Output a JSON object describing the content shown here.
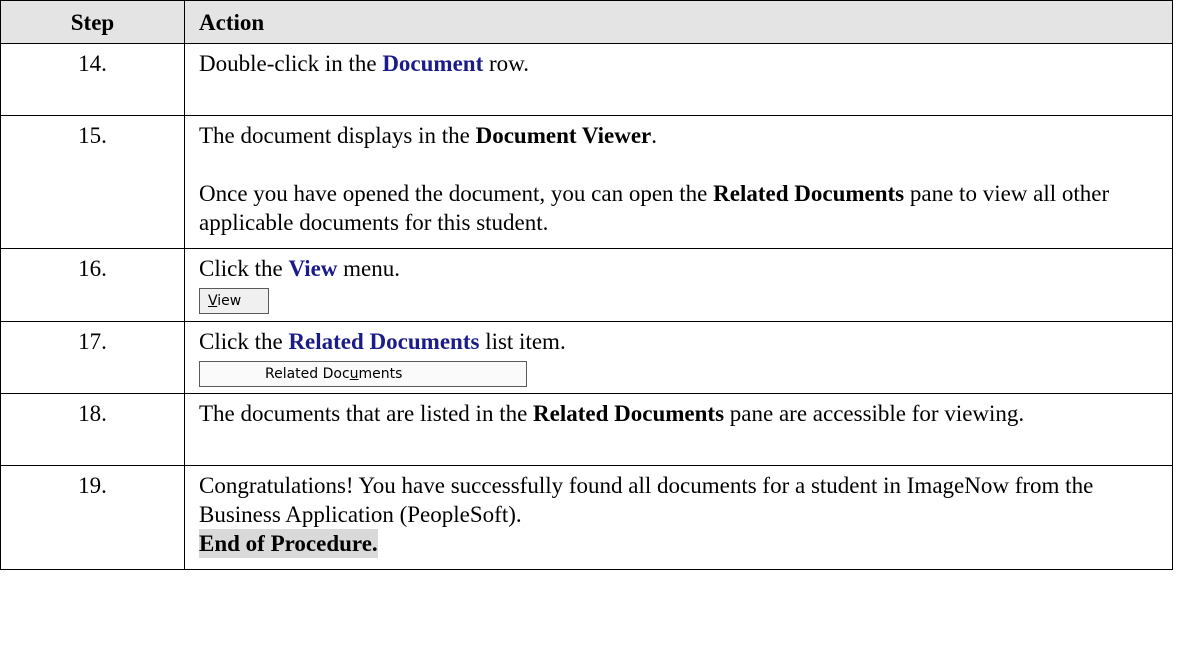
{
  "header": {
    "step": "Step",
    "action": "Action"
  },
  "rows": [
    {
      "num": "14.",
      "pre": "Double-click in the ",
      "em": "Document",
      "post": " row."
    },
    {
      "num": "15.",
      "pre": "The document displays in the ",
      "em": "Document Viewer",
      "post": ".",
      "p2_pre": "Once you have opened the document, you can open the ",
      "p2_em": "Related Documents",
      "p2_post": " pane to view all other applicable documents for this student."
    },
    {
      "num": "16.",
      "pre": "Click the ",
      "em": "View",
      "post": " menu.",
      "button": {
        "label_pre": "",
        "label_ul": "V",
        "label_post": "iew"
      }
    },
    {
      "num": "17.",
      "pre": "Click the ",
      "em": "Related Documents",
      "post": " list item.",
      "button": {
        "label_pre": "Related Doc",
        "label_ul": "u",
        "label_post": "ments"
      }
    },
    {
      "num": "18.",
      "pre": "The documents that are listed in the ",
      "em": "Related Documents",
      "post": " pane are accessible for viewing."
    },
    {
      "num": "19.",
      "text": "Congratulations! You have successfully found all documents for a student in ImageNow from the Business Application (PeopleSoft).",
      "end": "End of Procedure."
    }
  ]
}
